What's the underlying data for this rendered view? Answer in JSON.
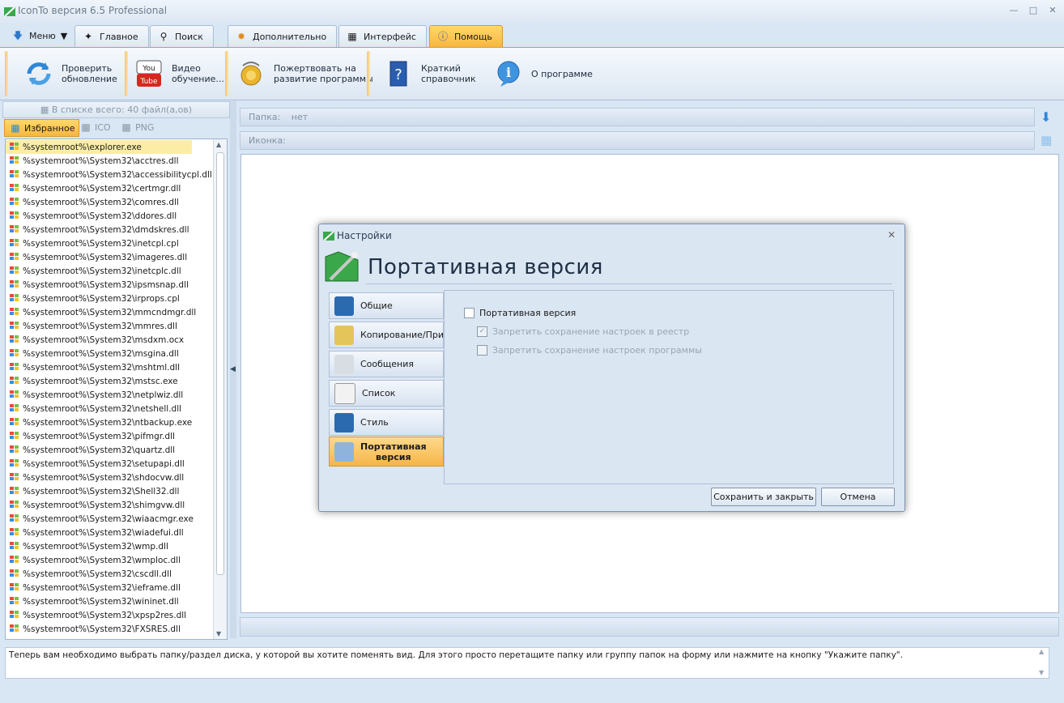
{
  "window": {
    "title": "IconTo версия 6.5 Professional"
  },
  "tabs": [
    {
      "label": "Меню"
    },
    {
      "label": "Главное"
    },
    {
      "label": "Поиск"
    },
    {
      "label": "Дополнительно"
    },
    {
      "label": "Интерфейс"
    },
    {
      "label": "Помощь"
    }
  ],
  "ribbon": [
    {
      "label": "Проверить\nобновление"
    },
    {
      "label": "Видео\nобучение..."
    },
    {
      "label": "Пожертвовать на\nразвитие программы"
    },
    {
      "label": "Краткий\nсправочник"
    },
    {
      "label": "О программе"
    }
  ],
  "left_panel": {
    "count_text": "В списке всего: 40 файл(а,ов)",
    "tabs": [
      {
        "label": "Избранное"
      },
      {
        "label": "ICO"
      },
      {
        "label": "PNG"
      }
    ],
    "files": [
      "%systemroot%\\explorer.exe",
      "%systemroot%\\System32\\acctres.dll",
      "%systemroot%\\System32\\accessibilitycpl.dll",
      "%systemroot%\\System32\\certmgr.dll",
      "%systemroot%\\System32\\comres.dll",
      "%systemroot%\\System32\\ddores.dll",
      "%systemroot%\\System32\\dmdskres.dll",
      "%systemroot%\\System32\\inetcpl.cpl",
      "%systemroot%\\System32\\imageres.dll",
      "%systemroot%\\System32\\inetcplc.dll",
      "%systemroot%\\System32\\ipsmsnap.dll",
      "%systemroot%\\System32\\irprops.cpl",
      "%systemroot%\\System32\\mmcndmgr.dll",
      "%systemroot%\\System32\\mmres.dll",
      "%systemroot%\\System32\\msdxm.ocx",
      "%systemroot%\\System32\\msgina.dll",
      "%systemroot%\\System32\\mshtml.dll",
      "%systemroot%\\System32\\mstsc.exe",
      "%systemroot%\\System32\\netplwiz.dll",
      "%systemroot%\\System32\\netshell.dll",
      "%systemroot%\\System32\\ntbackup.exe",
      "%systemroot%\\System32\\pifmgr.dll",
      "%systemroot%\\System32\\quartz.dll",
      "%systemroot%\\System32\\setupapi.dll",
      "%systemroot%\\System32\\shdocvw.dll",
      "%systemroot%\\System32\\Shell32.dll",
      "%systemroot%\\System32\\shimgvw.dll",
      "%systemroot%\\System32\\wiaacmgr.exe",
      "%systemroot%\\System32\\wiadefui.dll",
      "%systemroot%\\System32\\wmp.dll",
      "%systemroot%\\System32\\wmploc.dll",
      "%systemroot%\\System32\\cscdll.dll",
      "%systemroot%\\System32\\ieframe.dll",
      "%systemroot%\\System32\\wininet.dll",
      "%systemroot%\\System32\\xpsp2res.dll",
      "%systemroot%\\System32\\FXSRES.dll"
    ]
  },
  "right_panel": {
    "folder_label": "Папка:",
    "folder_value": "нет",
    "icon_label": "Иконка:"
  },
  "status_text": "Теперь вам необходимо выбрать папку/раздел диска, у которой вы хотите поменять вид. Для этого просто перетащите папку или группу папок на форму или нажмите на кнопку \"Укажите папку\".",
  "dialog": {
    "title": "Настройки",
    "heading": "Портативная версия",
    "nav": [
      {
        "label": "Общие"
      },
      {
        "label": "Копирование/Применение"
      },
      {
        "label": "Сообщения"
      },
      {
        "label": "Список"
      },
      {
        "label": "Стиль"
      },
      {
        "label": "Портативная\nверсия"
      }
    ],
    "options": [
      {
        "label": "Портативная версия",
        "checked": false,
        "enabled": true
      },
      {
        "label": "Запретить сохранение настроек в реестр",
        "checked": true,
        "enabled": false
      },
      {
        "label": "Запретить сохранение настроек программы",
        "checked": false,
        "enabled": false
      }
    ],
    "save_label": "Сохранить и закрыть",
    "cancel_label": "Отмена"
  }
}
